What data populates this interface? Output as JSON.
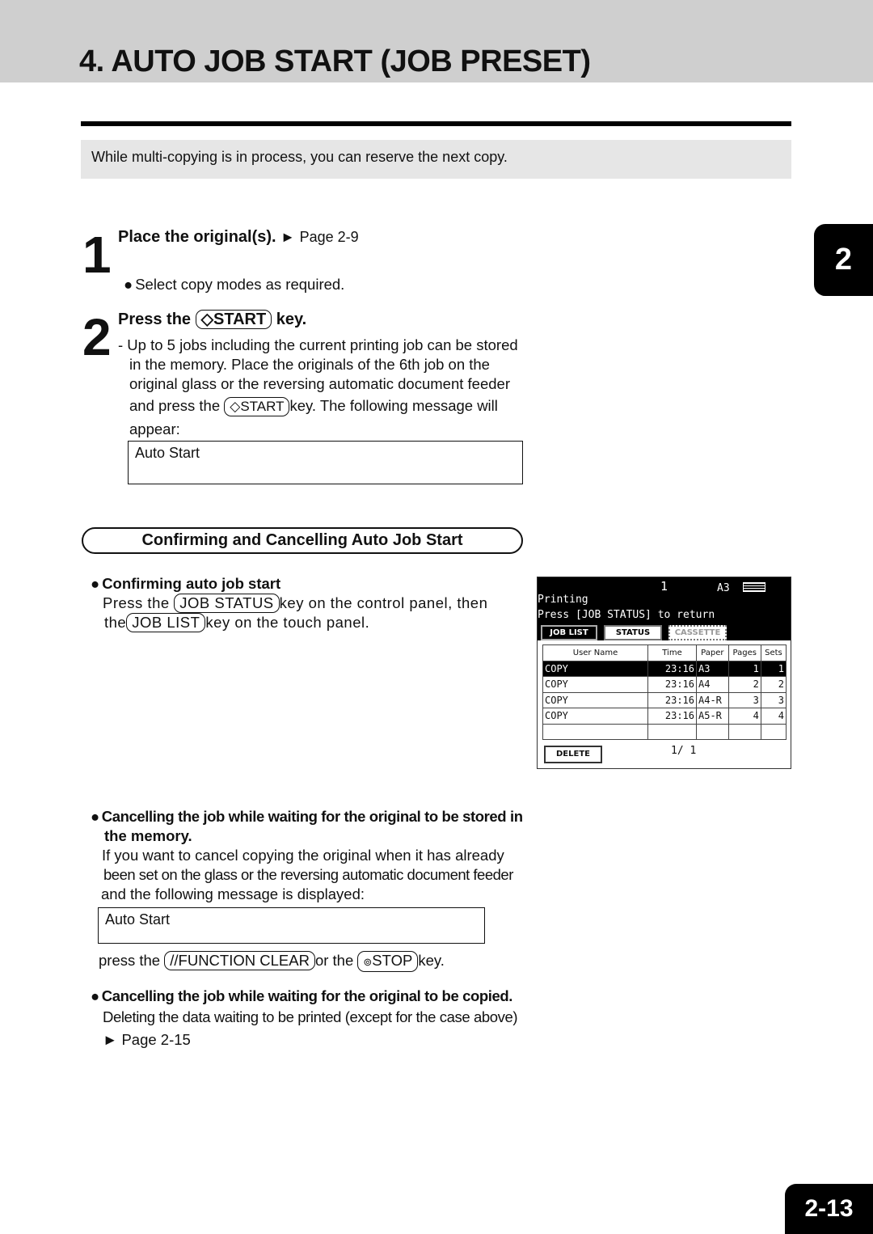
{
  "title": "4. AUTO JOB START (JOB PRESET)",
  "intro": "While multi-copying is in process, you can reserve the next copy.",
  "chapter_tab": "2",
  "step1": {
    "num": "1",
    "heading": "Place the original(s).",
    "ref": "Page 2-9",
    "bullet": "Select copy modes as required."
  },
  "step2": {
    "num": "2",
    "heading_pre": "Press the",
    "key": "START",
    "heading_post": "key.",
    "lines": [
      "- Up to 5 jobs including the current printing job can be stored",
      "in the memory. Place the originals of the 6th job on the",
      "original glass or the reversing automatic document feeder"
    ],
    "line4_pre": "and press the",
    "line4_post": "key. The following message will",
    "line5": "appear:",
    "message": "Auto Start"
  },
  "confirm": {
    "title": "Confirming and Cancelling Auto Job Start",
    "sub1": "Confirming auto job start",
    "l1_pre": "Press the",
    "key_job_status": "JOB STATUS",
    "l1_post": "key on the control panel, then",
    "l2_pre": "the",
    "key_job_list": "JOB LIST",
    "l2_post": "key on the touch panel.",
    "sub2a": "Cancelling the job while waiting for the original to be  stored in",
    "sub2b": "the memory.",
    "s2lines": [
      "If you want to cancel copying the original when it has already",
      "been set on the glass or the reversing automatic document feeder",
      "and the following message is displayed:"
    ],
    "message": "Auto Start",
    "press_pre": "press the",
    "key_clear": "FUNCTION CLEAR",
    "or": "or the",
    "key_stop": "STOP",
    "press_post": "key.",
    "sub3": "Cancelling the job while waiting for the original to be  copied.",
    "s3line": "Deleting the data waiting to be printed (except for the case  above)",
    "s3ref": "Page 2-15"
  },
  "panel": {
    "count": "1",
    "paper": "A3",
    "status": "Printing",
    "hint": "Press [JOB STATUS] to return",
    "tabs": [
      "JOB LIST",
      "STATUS",
      "CASSETTE"
    ],
    "headers": [
      "User Name",
      "Time",
      "Paper",
      "Pages",
      "Sets"
    ],
    "rows": [
      [
        "COPY",
        "23:16",
        "A3",
        "1",
        "1"
      ],
      [
        "COPY",
        "23:16",
        "A4",
        "2",
        "2"
      ],
      [
        "COPY",
        "23:16",
        "A4-R",
        "3",
        "3"
      ],
      [
        "COPY",
        "23:16",
        "A5-R",
        "4",
        "4"
      ]
    ],
    "delete": "DELETE",
    "page": "1/ 1"
  },
  "page_number": "2-13"
}
